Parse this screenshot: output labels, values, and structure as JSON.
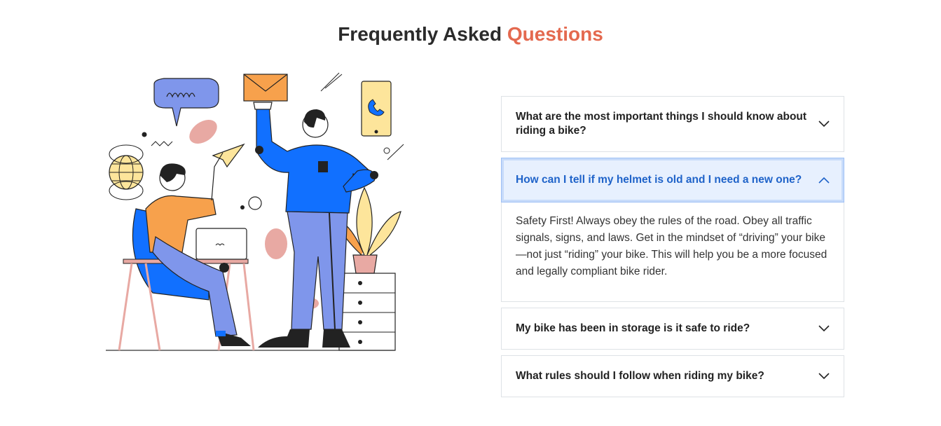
{
  "heading": {
    "part1": "Frequently Asked",
    "part2": "Questions"
  },
  "colors": {
    "accent": "#e4694f",
    "active_text": "#1f63c9",
    "active_bg": "#e7f0fe",
    "figure_blue": "#1170ff"
  },
  "faq": [
    {
      "question": "What are the most important things I should know about riding a bike?",
      "expanded": false
    },
    {
      "question": "How can I tell if my helmet is old and I need a new one?",
      "expanded": true,
      "answer": "Safety First! Always obey the rules of the road. Obey all traffic signals, signs, and laws. Get in the mindset of “driving” your bike—not just “riding” your bike. This will help you be a more focused and legally compliant bike rider."
    },
    {
      "question": "My bike has been in storage is it safe to ride?",
      "expanded": false
    },
    {
      "question": "What rules should I follow when riding my bike?",
      "expanded": false
    }
  ],
  "icons": {
    "collapsed": "chevron-down-icon",
    "expanded": "chevron-up-icon"
  }
}
